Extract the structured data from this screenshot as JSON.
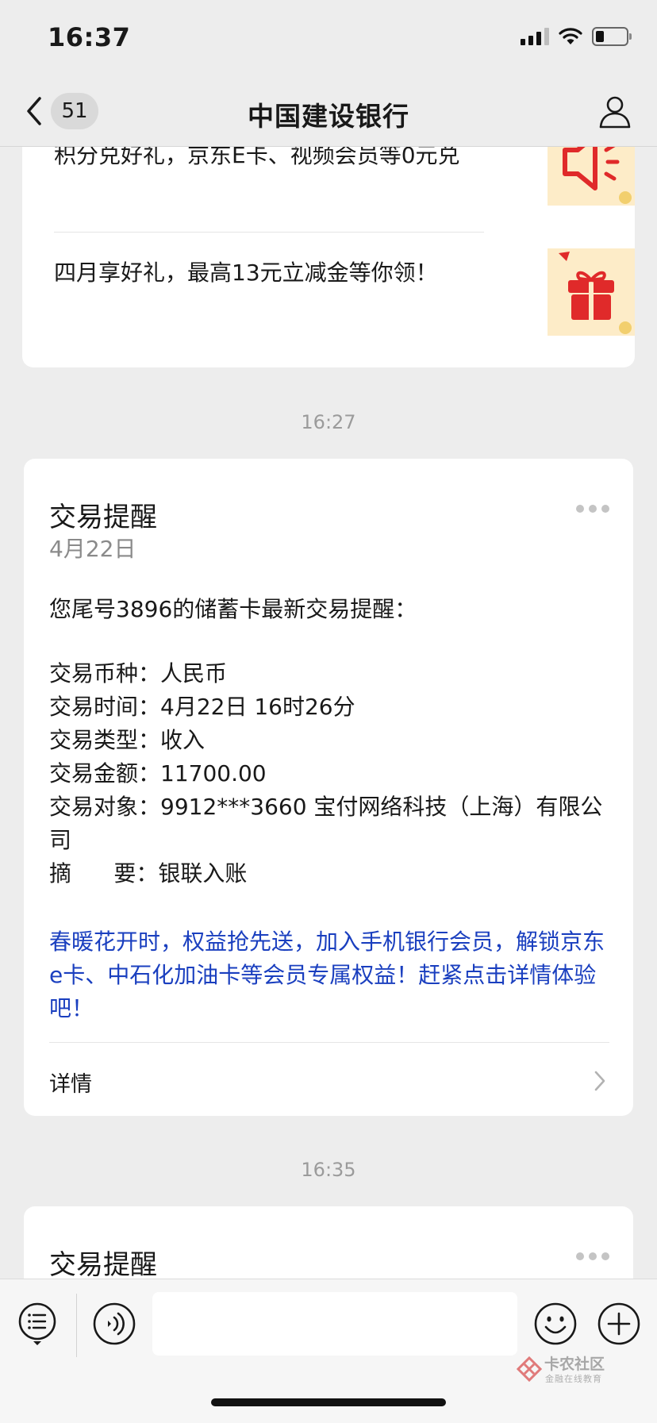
{
  "status_bar": {
    "time": "16:37",
    "icons": [
      "cellular-signal-icon",
      "wifi-icon",
      "battery-icon"
    ]
  },
  "nav": {
    "badge_count": "51",
    "title": "中国建设银行",
    "icons": [
      "chevron-left-icon",
      "person-icon"
    ]
  },
  "promo_card": {
    "items": [
      {
        "text": "积分兑好礼，京东E卡、视频会员等0元兑",
        "thumb_icon": "megaphone-icon"
      },
      {
        "text": "四月享好礼，最高13元立减金等你领！",
        "thumb_icon": "gift-icon"
      }
    ],
    "thumb_bg": "#fdecc8",
    "icon_color": "#e02a2a"
  },
  "messages": [
    {
      "time": "16:27",
      "title": "交易提醒",
      "date": "4月22日",
      "intro": "您尾号3896的储蓄卡最新交易提醒：",
      "rows": [
        {
          "label": "交易币种：",
          "value": "人民币"
        },
        {
          "label": "交易时间：",
          "value": "4月22日 16时26分"
        },
        {
          "label": "交易类型：",
          "value": "收入"
        },
        {
          "label": "交易金额：",
          "value": "11700.00"
        },
        {
          "label": "交易对象：",
          "value": "9912***3660 宝付网络科技（上海）有限公司"
        },
        {
          "label": "摘      要：",
          "value": "银联入账"
        }
      ],
      "promo": "春暖花开时，权益抢先送，加入手机银行会员，解锁京东e卡、中石化加油卡等会员专属权益！赶紧点击详情体验吧！",
      "details_label": "详情"
    },
    {
      "time": "16:35",
      "title": "交易提醒"
    }
  ],
  "bottom_bar": {
    "input_value": "",
    "icons": [
      "menu-list-icon",
      "voice-icon",
      "emoji-icon",
      "plus-icon"
    ]
  },
  "watermark": {
    "name": "卡农社区",
    "sub": "金融在线教育"
  },
  "colors": {
    "background": "#ededed",
    "card": "#ffffff",
    "link_blue": "#1a3fbf",
    "muted": "#9b9b9b"
  }
}
